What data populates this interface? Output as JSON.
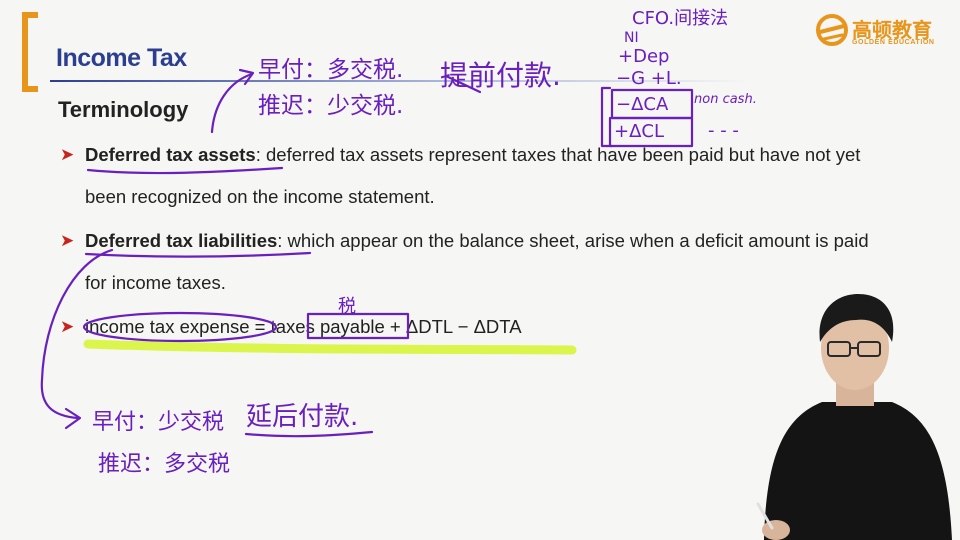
{
  "slide": {
    "title": "Income Tax",
    "section": "Terminology",
    "bullets": [
      {
        "term": "Deferred tax assets",
        "body": ": deferred tax assets represent taxes that have been paid but have not yet been recognized on the income statement."
      },
      {
        "term": "Deferred tax liabilities",
        "body": ": which appear on the balance sheet, arise when a deficit amount is paid for income taxes."
      },
      {
        "term": "",
        "body": "income tax expense = taxes payable + ΔDTL − ΔDTA"
      }
    ]
  },
  "logo": {
    "cn": "高顿教育",
    "en": "GOLDEN EDUCATION"
  },
  "annotations": {
    "top_line1": "早付：多交税.",
    "top_line2": "推迟：少交税.",
    "top_middle": "提前付款.",
    "cfo_title": "CFO.间接法",
    "cfo_ni": "NI",
    "cfo_dep": "+Dep",
    "cfo_g": "−G  +L.",
    "cfo_ca": "−ΔCA",
    "cfo_noncash": "non cash.",
    "cfo_cl": "+ΔCL",
    "cfo_dash": "- - -",
    "tax_label": "税",
    "bottom_line1": "早付：少交税",
    "bottom_line2": "推迟：多交税",
    "bottom_right": "延后付款."
  },
  "colors": {
    "title": "#2c3e8f",
    "accent": "#e8951c",
    "bullet_marker": "#c8241e",
    "ink": "#6a1fbf",
    "highlight": "#d9f53a"
  }
}
